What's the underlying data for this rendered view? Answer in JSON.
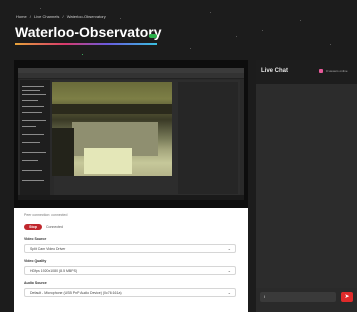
{
  "breadcrumb": {
    "items": [
      "Home",
      "/",
      "Live Channels",
      "/",
      "Waterloo-Observatory"
    ]
  },
  "page": {
    "title": "Waterloo-Observatory",
    "status_color": "#2bb04a"
  },
  "stream": {
    "status_text": "Peer connection: connected",
    "stop_label": "Stop",
    "connection_label": "Connected"
  },
  "controls": {
    "video_source": {
      "label": "Video Source",
      "value": "Split Cam Video Driver"
    },
    "video_quality": {
      "label": "Video Quality",
      "value": "HDfps 1920x1080 (8.5 MBPS)"
    },
    "audio_source": {
      "label": "Audio Source",
      "value": "Default - Microphone (USB PnP Audio Device) (0c76:161a)"
    }
  },
  "chat": {
    "title": "Live Chat",
    "viewers": "0 viewers online",
    "input_value": "I",
    "send_icon": "send-icon"
  },
  "colors": {
    "accent_red": "#c0272d",
    "send_red": "#e02a2a",
    "background": "#1c1c1c"
  }
}
